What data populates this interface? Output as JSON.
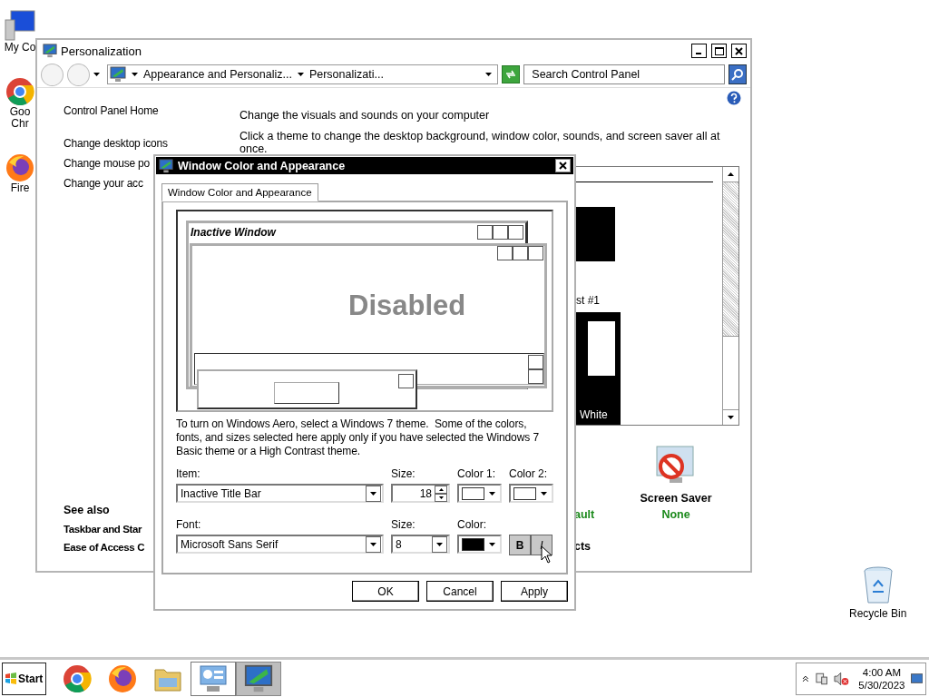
{
  "desktop_icons": [
    {
      "kind": "computer",
      "lines": [
        "My Co"
      ]
    },
    {
      "kind": "chrome",
      "lines": [
        "Goo",
        "Chr"
      ]
    },
    {
      "kind": "firefox",
      "lines": [
        "Fire"
      ]
    }
  ],
  "recycle_bin": {
    "label": "Recycle Bin"
  },
  "personalization": {
    "title": "Personalization",
    "address": {
      "segments": [
        "Appearance and Personaliz...",
        "Personalizati..."
      ]
    },
    "search": {
      "placeholder": "Search Control Panel"
    },
    "tasks": [
      "Control Panel Home",
      "Change desktop icons",
      "Change mouse po",
      "Change your acc"
    ],
    "see_also": {
      "heading": "See also",
      "links": [
        "Taskbar and Star",
        "Ease of Access C"
      ]
    },
    "heading": "Change the visuals and sounds on your computer",
    "intro": "Click a theme to change the desktop background, window color, sounds, and screen saver all at once.",
    "themes": [
      {
        "label": "st #1",
        "color": "#000000",
        "selected": false
      },
      {
        "label": "White",
        "color": "#ffffff",
        "selected": true
      }
    ],
    "fragments": [
      {
        "kind": "value",
        "text": "ault"
      },
      {
        "kind": "label",
        "text": "cts"
      }
    ],
    "screen_saver": {
      "label": "Screen Saver",
      "value": "None"
    }
  },
  "dialog": {
    "title": "Window Color and Appearance",
    "tabs": [
      {
        "label": "Window Color and Appearance",
        "selected": true
      }
    ],
    "preview": {
      "inactive_title": "Inactive Window",
      "disabled_text": "Disabled"
    },
    "note": "To turn on Windows Aero, select a Windows 7 theme.  Some of the colors, fonts, and sizes selected here apply only if you have selected the Windows 7 Basic theme or a High Contrast theme.",
    "item": {
      "label": "Item:",
      "value": "Inactive Title Bar"
    },
    "item_size": {
      "label": "Size:",
      "value": "18"
    },
    "color1": {
      "label": "Color 1:",
      "color": "#ffffff"
    },
    "color2": {
      "label": "Color 2:",
      "color": "#ffffff"
    },
    "font": {
      "label": "Font:",
      "value": "Microsoft Sans Serif"
    },
    "font_size": {
      "label": "Size:",
      "value": "8"
    },
    "font_color": {
      "label": "Color:",
      "color": "#000000"
    },
    "bold": {
      "label": "B",
      "on": true
    },
    "italic": {
      "label": "I",
      "on": true
    },
    "buttons": [
      "OK",
      "Cancel",
      "Apply"
    ]
  },
  "taskbar": {
    "start": "Start",
    "apps": [
      {
        "kind": "chrome",
        "selected": false,
        "outlined": false
      },
      {
        "kind": "firefox",
        "selected": false,
        "outlined": false
      },
      {
        "kind": "explorer",
        "selected": false,
        "outlined": false
      },
      {
        "kind": "control-panel",
        "selected": false,
        "outlined": true
      },
      {
        "kind": "personalization",
        "selected": true,
        "outlined": false
      }
    ],
    "clock": {
      "time": "4:00 AM",
      "date": "5/30/2023"
    }
  }
}
